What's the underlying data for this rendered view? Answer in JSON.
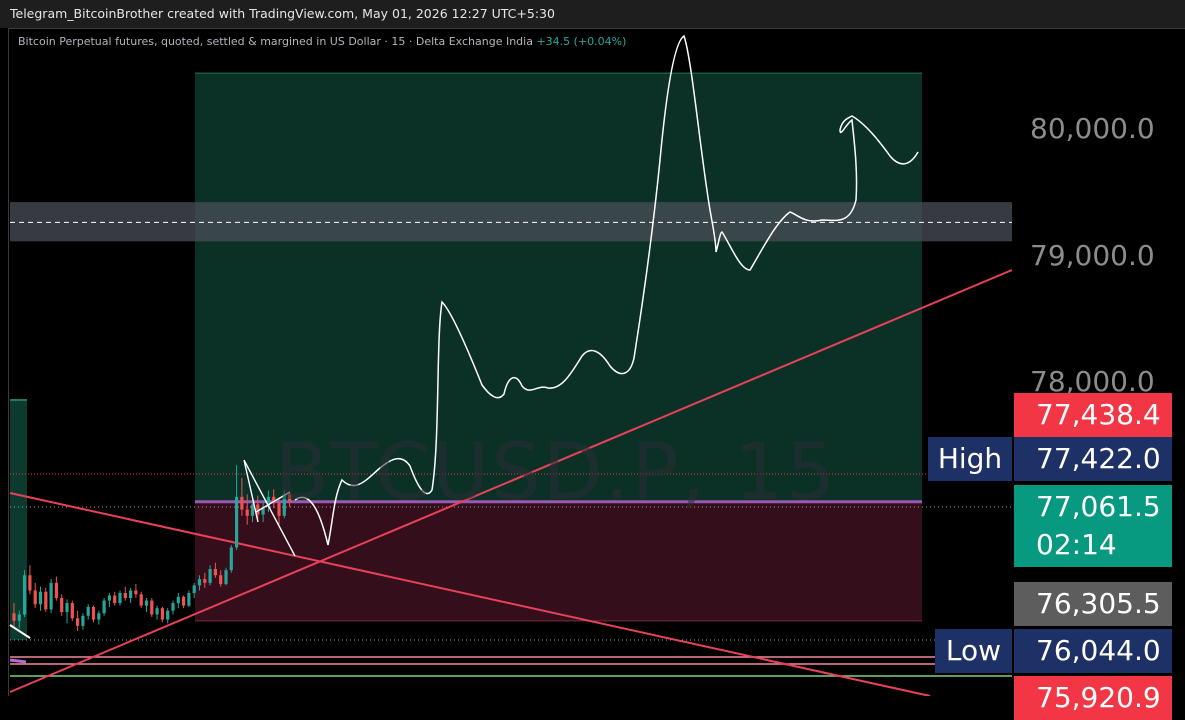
{
  "top_bar": {
    "title": "Telegram_BitcoinBrother created with TradingView.com, May 01, 2026 12:27 UTC+5:30"
  },
  "legend": {
    "description": "Bitcoin Perpetual futures, quoted, settled & margined in US Dollar · 15 · Delta Exchange India",
    "change": "+34.5 (+0.04%)"
  },
  "watermark": "BTCUSD.P, 15",
  "colors": {
    "background": "#000000",
    "profit_zone": "#0d3a2e",
    "loss_zone": "#3a0f1e",
    "bull_candle": "#26a69a",
    "bear_candle": "#ef5350",
    "trendline": "#e8415a",
    "entry_line": "#9b59b6",
    "high_low_tag": "#1e3166",
    "price_red": "#f23645",
    "price_green": "#089981",
    "price_gray": "#5d5d5d"
  },
  "chart_data": {
    "type": "candlestick",
    "symbol": "BTCUSD.P",
    "timeframe": "15",
    "y_range": [
      75880,
      80650
    ],
    "y_ticks": [
      {
        "value": 80000,
        "label": "80,000.0"
      },
      {
        "value": 79000,
        "label": "79,000.0"
      },
      {
        "value": 78000,
        "label": "78,000.0"
      }
    ],
    "price_labels": [
      {
        "value": 77438.4,
        "label": "77,438.4",
        "kind": "red"
      },
      {
        "value": 77422.0,
        "label": "77,422.0",
        "kind": "high",
        "tag": "High"
      },
      {
        "value": 77061.5,
        "label": "77,061.5",
        "kind": "current",
        "countdown": "02:14"
      },
      {
        "value": 76305.5,
        "label": "76,305.5",
        "kind": "gray"
      },
      {
        "value": 76044.0,
        "label": "76,044.0",
        "kind": "low",
        "tag": "Low"
      },
      {
        "value": 75920.9,
        "label": "75,920.9",
        "kind": "red"
      }
    ],
    "position": {
      "type": "long",
      "entry": 77061.5,
      "target": 80450,
      "stop": 76120
    },
    "resistance_zone": {
      "low": 79120,
      "high": 79430,
      "mid": 79270
    },
    "candles": [
      {
        "o": 76180,
        "h": 76260,
        "l": 76080,
        "c": 76120
      },
      {
        "o": 76120,
        "h": 76200,
        "l": 76060,
        "c": 76170
      },
      {
        "o": 76170,
        "h": 76520,
        "l": 76150,
        "c": 76480
      },
      {
        "o": 76480,
        "h": 76560,
        "l": 76330,
        "c": 76360
      },
      {
        "o": 76360,
        "h": 76420,
        "l": 76220,
        "c": 76250
      },
      {
        "o": 76250,
        "h": 76390,
        "l": 76200,
        "c": 76350
      },
      {
        "o": 76350,
        "h": 76380,
        "l": 76190,
        "c": 76210
      },
      {
        "o": 76210,
        "h": 76450,
        "l": 76180,
        "c": 76420
      },
      {
        "o": 76420,
        "h": 76470,
        "l": 76280,
        "c": 76300
      },
      {
        "o": 76300,
        "h": 76330,
        "l": 76160,
        "c": 76190
      },
      {
        "o": 76190,
        "h": 76290,
        "l": 76100,
        "c": 76260
      },
      {
        "o": 76260,
        "h": 76280,
        "l": 76120,
        "c": 76140
      },
      {
        "o": 76140,
        "h": 76200,
        "l": 76040,
        "c": 76080
      },
      {
        "o": 76080,
        "h": 76180,
        "l": 76050,
        "c": 76160
      },
      {
        "o": 76160,
        "h": 76250,
        "l": 76130,
        "c": 76230
      },
      {
        "o": 76230,
        "h": 76240,
        "l": 76110,
        "c": 76130
      },
      {
        "o": 76130,
        "h": 76200,
        "l": 76090,
        "c": 76180
      },
      {
        "o": 76180,
        "h": 76300,
        "l": 76160,
        "c": 76280
      },
      {
        "o": 76280,
        "h": 76340,
        "l": 76230,
        "c": 76320
      },
      {
        "o": 76320,
        "h": 76350,
        "l": 76240,
        "c": 76260
      },
      {
        "o": 76260,
        "h": 76360,
        "l": 76240,
        "c": 76340
      },
      {
        "o": 76340,
        "h": 76390,
        "l": 76280,
        "c": 76300
      },
      {
        "o": 76300,
        "h": 76380,
        "l": 76260,
        "c": 76360
      },
      {
        "o": 76360,
        "h": 76410,
        "l": 76300,
        "c": 76330
      },
      {
        "o": 76330,
        "h": 76350,
        "l": 76220,
        "c": 76240
      },
      {
        "o": 76240,
        "h": 76300,
        "l": 76190,
        "c": 76280
      },
      {
        "o": 76280,
        "h": 76300,
        "l": 76150,
        "c": 76170
      },
      {
        "o": 76170,
        "h": 76240,
        "l": 76130,
        "c": 76220
      },
      {
        "o": 76220,
        "h": 76230,
        "l": 76110,
        "c": 76130
      },
      {
        "o": 76130,
        "h": 76220,
        "l": 76100,
        "c": 76200
      },
      {
        "o": 76200,
        "h": 76280,
        "l": 76170,
        "c": 76260
      },
      {
        "o": 76260,
        "h": 76340,
        "l": 76220,
        "c": 76310
      },
      {
        "o": 76310,
        "h": 76320,
        "l": 76220,
        "c": 76240
      },
      {
        "o": 76240,
        "h": 76360,
        "l": 76230,
        "c": 76340
      },
      {
        "o": 76340,
        "h": 76420,
        "l": 76300,
        "c": 76400
      },
      {
        "o": 76400,
        "h": 76480,
        "l": 76360,
        "c": 76450
      },
      {
        "o": 76450,
        "h": 76500,
        "l": 76380,
        "c": 76420
      },
      {
        "o": 76420,
        "h": 76560,
        "l": 76400,
        "c": 76530
      },
      {
        "o": 76530,
        "h": 76580,
        "l": 76460,
        "c": 76480
      },
      {
        "o": 76480,
        "h": 76520,
        "l": 76390,
        "c": 76410
      },
      {
        "o": 76410,
        "h": 76540,
        "l": 76400,
        "c": 76520
      },
      {
        "o": 76520,
        "h": 76720,
        "l": 76500,
        "c": 76700
      },
      {
        "o": 76700,
        "h": 77350,
        "l": 76680,
        "c": 77100
      },
      {
        "o": 77100,
        "h": 77250,
        "l": 76950,
        "c": 77000
      },
      {
        "o": 77000,
        "h": 77120,
        "l": 76880,
        "c": 76950
      },
      {
        "o": 76950,
        "h": 77080,
        "l": 76900,
        "c": 77040
      },
      {
        "o": 77040,
        "h": 77110,
        "l": 76920,
        "c": 76960
      },
      {
        "o": 76960,
        "h": 77060,
        "l": 76900,
        "c": 77020
      },
      {
        "o": 77020,
        "h": 77150,
        "l": 76980,
        "c": 77100
      },
      {
        "o": 77100,
        "h": 77160,
        "l": 77010,
        "c": 77050
      },
      {
        "o": 77050,
        "h": 77080,
        "l": 76880,
        "c": 76950
      },
      {
        "o": 76950,
        "h": 77150,
        "l": 76930,
        "c": 77120
      },
      {
        "o": 77120,
        "h": 77140,
        "l": 77020,
        "c": 77061.5
      }
    ]
  }
}
